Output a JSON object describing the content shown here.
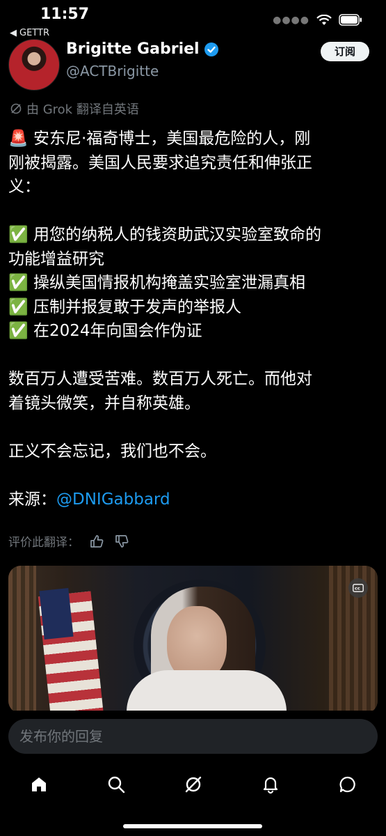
{
  "status_bar": {
    "time": "11:57",
    "back_app": "GETTR"
  },
  "post": {
    "author_name": "Brigitte Gabriel",
    "handle": "@ACTBrigitte",
    "subscribe_label": "订阅",
    "translated_note": "由 Grok 翻译自英语",
    "lines": [
      "🚨 安东尼·福奇博士，美国最危险的人，刚",
      "刚被揭露。美国人民要求追究责任和伸张正",
      "义：",
      "",
      "✅ 用您的纳税人的钱资助武汉实验室致命的",
      "功能增益研究",
      "✅ 操纵美国情报机构掩盖实验室泄漏真相",
      "✅ 压制并报复敢于发声的举报人",
      "✅ 在2024年向国会作伪证",
      "",
      "数百万人遭受苦难。数百万人死亡。而他对",
      "着镜头微笑，并自称英雄。",
      "",
      "正义不会忘记，我们也不会。",
      ""
    ],
    "source_label": "来源：",
    "source_mention": "@DNIGabbard",
    "rate_label": "评价此翻译："
  },
  "reply": {
    "placeholder": "发布你的回复"
  },
  "icons": {
    "verified": "verified-badge-icon",
    "back": "back-arrow-icon",
    "signal": "signal-icon",
    "wifi": "wifi-icon",
    "battery": "battery-icon",
    "grok": "grok-icon",
    "thumbs_up": "thumbs-up-icon",
    "thumbs_down": "thumbs-down-icon",
    "cc": "closed-captions-icon",
    "nav_home": "home-icon",
    "nav_search": "search-icon",
    "nav_grok": "grok-icon",
    "nav_notifications": "bell-icon",
    "nav_messages": "message-icon"
  },
  "colors": {
    "background": "#000000",
    "link": "#1d9bf0",
    "muted": "#71767b",
    "verified": "#1d9bf0"
  }
}
